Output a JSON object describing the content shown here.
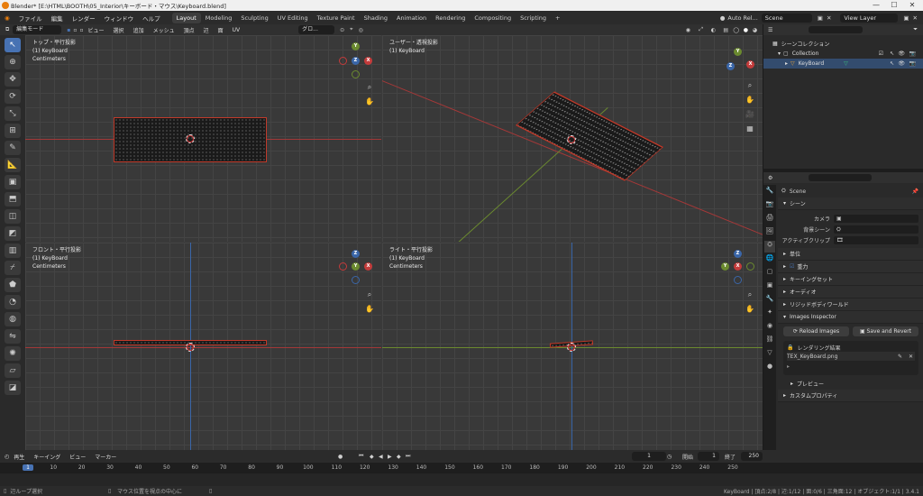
{
  "window": {
    "title": "Blender* [E:\\HTML\\BOOTH\\05_Interior\\キーボード・マウス\\Keyboard.blend]",
    "min": "—",
    "max": "☐",
    "close": "✕"
  },
  "menus": [
    "ファイル",
    "編集",
    "レンダー",
    "ウィンドウ",
    "ヘルプ"
  ],
  "workspaces": [
    "Layout",
    "Modeling",
    "Sculpting",
    "UV Editing",
    "Texture Paint",
    "Shading",
    "Animation",
    "Rendering",
    "Compositing",
    "Scripting",
    "+"
  ],
  "topbar_right": {
    "auto": "Auto Rel...",
    "scene": "Scene",
    "view_layer": "View Layer"
  },
  "viewport_header": {
    "mode": "編集モード",
    "items": [
      "ビュー",
      "選択",
      "追加",
      "メッシュ",
      "頂点",
      "辺",
      "面",
      "UV"
    ],
    "orientation": "グロ..."
  },
  "views": {
    "top": {
      "line1": "トップ・平行投影",
      "line2": "(1) KeyBoard",
      "line3": "Centimeters"
    },
    "user": {
      "line1": "ユーザー・透視投影",
      "line2": "(1) KeyBoard"
    },
    "front": {
      "line1": "フロント・平行投影",
      "line2": "(1) KeyBoard",
      "line3": "Centimeters"
    },
    "right": {
      "line1": "ライト・平行投影",
      "line2": "(1) KeyBoard",
      "line3": "Centimeters"
    }
  },
  "gizmo": {
    "x": "X",
    "y": "Y",
    "z": "Z"
  },
  "outliner": {
    "root": "シーンコレクション",
    "collection": "Collection",
    "object": "KeyBoard"
  },
  "properties": {
    "scene_name": "Scene",
    "scene_panel": "シーン",
    "camera_label": "カメラ",
    "bg_scene_label": "背景シーン",
    "active_clip_label": "アクティブクリップ",
    "panels": [
      "単位",
      "重力",
      "キーイングセット",
      "オーディオ",
      "リジッドボディワールド"
    ],
    "images_inspector": "Images Inspector",
    "reload_images": "Reload Images",
    "save_and_revert": "Save and Revert",
    "render_result": "レンダリング結果",
    "image_file": "TEX_KeyBoard.png",
    "preview": "プレビュー",
    "custom_props": "カスタムプロパティ"
  },
  "timeline": {
    "playback": "再生",
    "keying": "キーイング",
    "view": "ビュー",
    "marker": "マーカー",
    "current_frame": "1",
    "start_label": "開始",
    "start": "1",
    "end_label": "終了",
    "end": "250",
    "ticks": [
      "1",
      "10",
      "20",
      "30",
      "40",
      "50",
      "60",
      "70",
      "80",
      "90",
      "100",
      "110",
      "120",
      "130",
      "140",
      "150",
      "160",
      "170",
      "180",
      "190",
      "200",
      "210",
      "220",
      "230",
      "240",
      "250"
    ]
  },
  "status": {
    "left": "辺ループ選択",
    "mid": "マウス位置を視点の中心に",
    "right": "KeyBoard | 頂点:2/8 | 辺:1/12 | 面:0/6 | 三角面:12 | オブジェクト:1/1 | 3.4.1"
  },
  "colors": {
    "accent": "#4772b3",
    "x_axis": "#c33b3b",
    "y_axis": "#6b8a2f",
    "z_axis": "#3a66a8"
  }
}
